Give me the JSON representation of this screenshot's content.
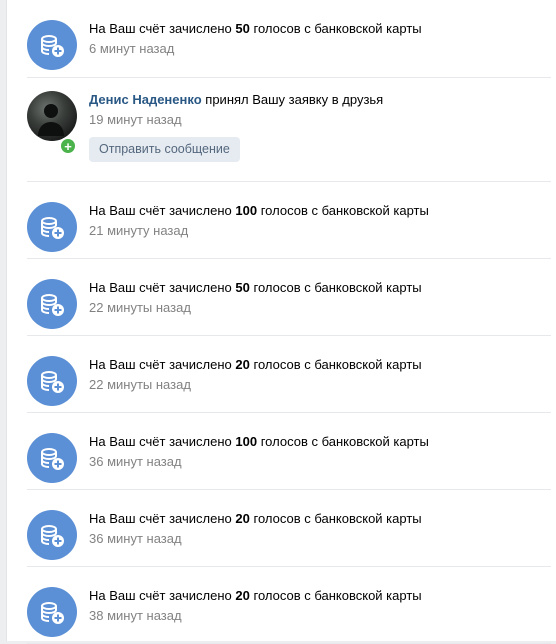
{
  "colors": {
    "icon_bg": "#5b8fd6",
    "badge_green": "#4bb34b",
    "link": "#2a5885",
    "muted": "#828282",
    "button_bg": "#e5ebf1"
  },
  "notifications": [
    {
      "type": "credit",
      "prefix": "На Ваш счёт зачислено",
      "amount": "50",
      "suffix": "голосов с банковской карты",
      "time": "6 минут назад",
      "icon": "coins-plus-icon"
    },
    {
      "type": "friend",
      "name": "Денис Надененко",
      "action": "принял Вашу заявку в друзья",
      "time": "19 минут назад",
      "button": "Отправить сообщение",
      "icon": "add-friend-badge-icon"
    },
    {
      "type": "credit",
      "prefix": "На Ваш счёт зачислено",
      "amount": "100",
      "suffix": "голосов с банковской карты",
      "time": "21 минуту назад",
      "icon": "coins-plus-icon"
    },
    {
      "type": "credit",
      "prefix": "На Ваш счёт зачислено",
      "amount": "50",
      "suffix": "голосов с банковской карты",
      "time": "22 минуты назад",
      "icon": "coins-plus-icon"
    },
    {
      "type": "credit",
      "prefix": "На Ваш счёт зачислено",
      "amount": "20",
      "suffix": "голосов с банковской карты",
      "time": "22 минуты назад",
      "icon": "coins-plus-icon"
    },
    {
      "type": "credit",
      "prefix": "На Ваш счёт зачислено",
      "amount": "100",
      "suffix": "голосов с банковской карты",
      "time": "36 минут назад",
      "icon": "coins-plus-icon"
    },
    {
      "type": "credit",
      "prefix": "На Ваш счёт зачислено",
      "amount": "20",
      "suffix": "голосов с банковской карты",
      "time": "36 минут назад",
      "icon": "coins-plus-icon"
    },
    {
      "type": "credit",
      "prefix": "На Ваш счёт зачислено",
      "amount": "20",
      "suffix": "голосов с банковской карты",
      "time": "38 минут назад",
      "icon": "coins-plus-icon"
    }
  ]
}
